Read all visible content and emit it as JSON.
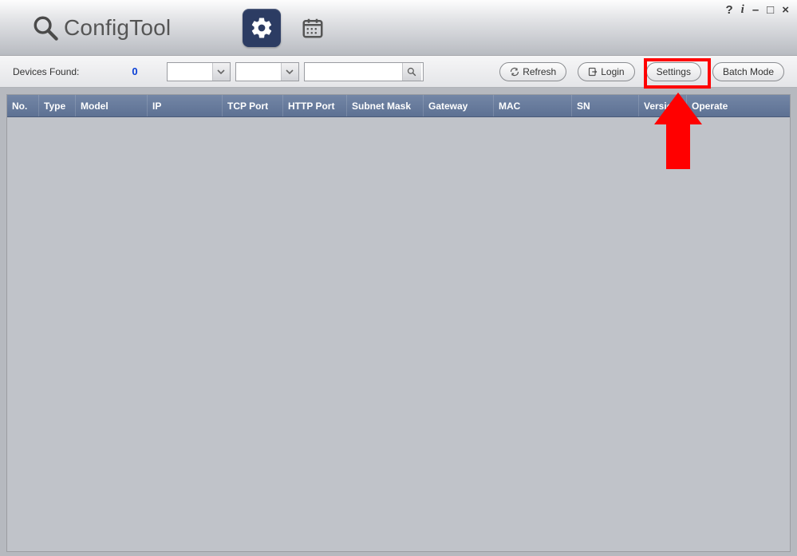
{
  "app": {
    "title": "ConfigTool"
  },
  "window_controls": {
    "help": "?",
    "info": "i",
    "minimize": "–",
    "maximize": "□",
    "close": "×"
  },
  "actionbar": {
    "devices_found_label": "Devices Found:",
    "devices_count": "0",
    "search_placeholder": "",
    "refresh_label": "Refresh",
    "login_label": "Login",
    "settings_label": "Settings",
    "batch_mode_label": "Batch Mode"
  },
  "table": {
    "columns": {
      "no": "No.",
      "type": "Type",
      "model": "Model",
      "ip": "IP",
      "tcp_port": "TCP Port",
      "http_port": "HTTP Port",
      "subnet_mask": "Subnet Mask",
      "gateway": "Gateway",
      "mac": "MAC",
      "sn": "SN",
      "version": "Version",
      "operate": "Operate"
    },
    "rows": []
  },
  "annotation": {
    "highlight_target": "settings-button"
  }
}
